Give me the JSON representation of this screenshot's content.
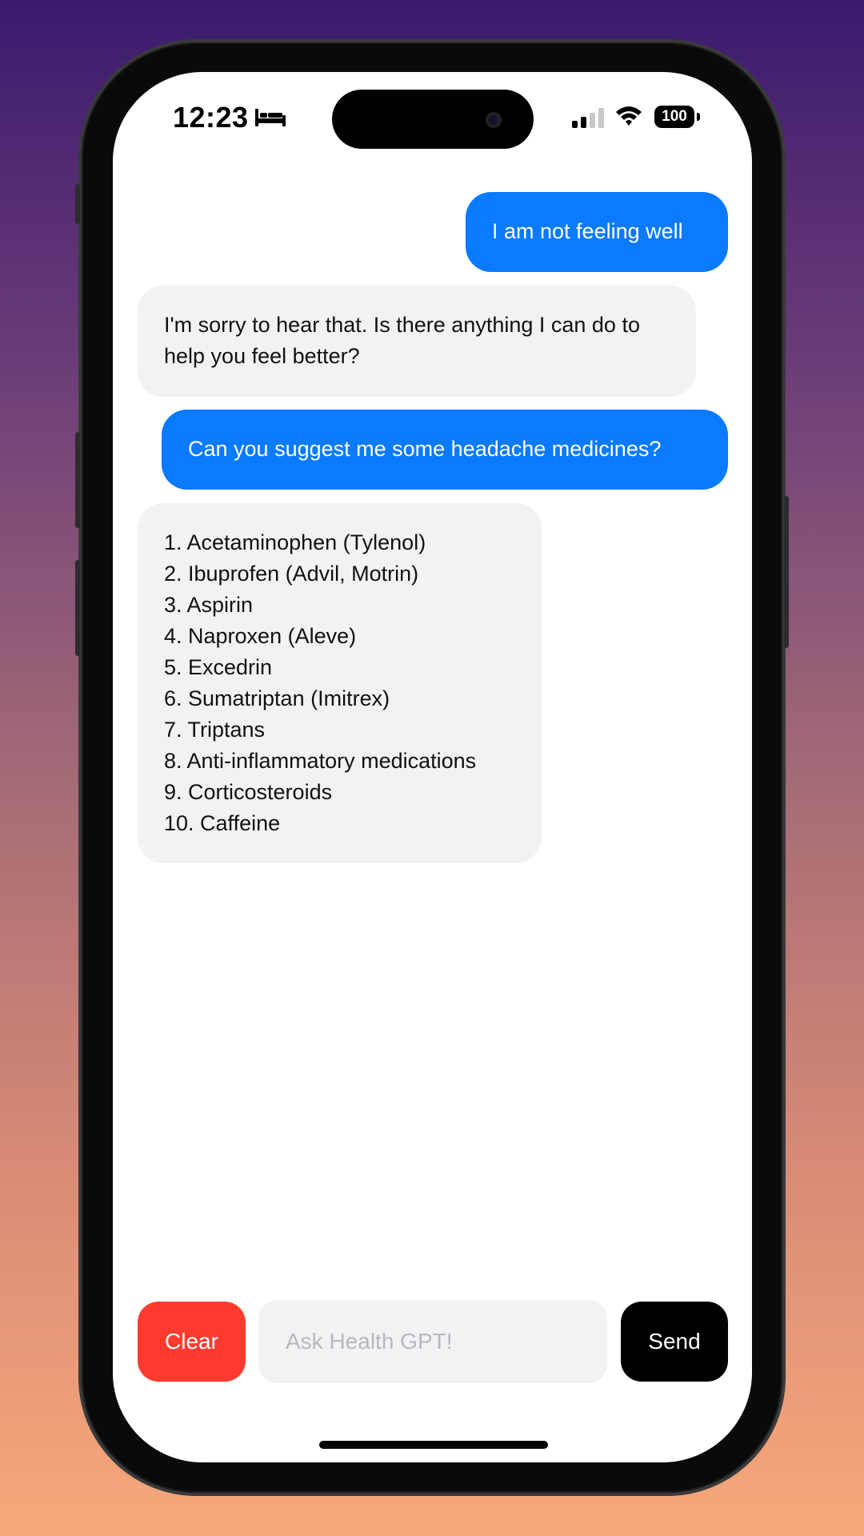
{
  "status_bar": {
    "time": "12:23",
    "battery": "100",
    "icons": [
      "bed-icon",
      "signal-icon",
      "wifi-icon",
      "battery-icon"
    ]
  },
  "chat": {
    "messages": [
      {
        "role": "user",
        "text": "I am not feeling well"
      },
      {
        "role": "assistant",
        "text": "I'm sorry to hear that. Is there anything I can do to help you feel better?"
      },
      {
        "role": "user",
        "text": "Can you suggest me some headache medicines?"
      },
      {
        "role": "assistant",
        "lines": [
          "1. Acetaminophen (Tylenol)",
          "2. Ibuprofen (Advil, Motrin)",
          "3. Aspirin",
          "4. Naproxen (Aleve)",
          "5. Excedrin",
          "6. Sumatriptan (Imitrex)",
          "7. Triptans",
          "8. Anti-inflammatory medications",
          "9. Corticosteroids",
          "10. Caffeine"
        ]
      }
    ]
  },
  "composer": {
    "clear_label": "Clear",
    "placeholder": "Ask Health GPT!",
    "send_label": "Send"
  },
  "colors": {
    "user_bubble": "#0a7aff",
    "assistant_bubble": "#f2f2f4",
    "clear_button": "#ff3b30",
    "send_button": "#000000"
  }
}
